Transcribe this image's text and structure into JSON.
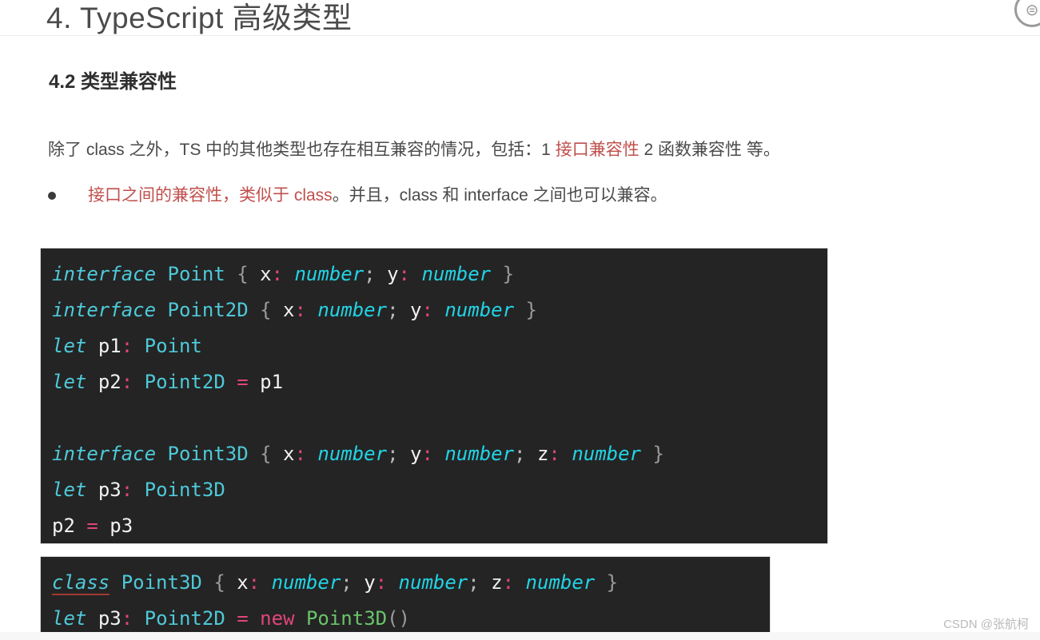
{
  "document": {
    "title": "4. TypeScript 高级类型",
    "section_title": "4.2 类型兼容性"
  },
  "corner_icon": {
    "name": "circular-badge-icon",
    "glyph": "⊜"
  },
  "paragraph": {
    "part1": "除了 class 之外，TS 中的其他类型也存在相互兼容的情况，包括：1 ",
    "highlight": "接口兼容性",
    "part2": " 2 函数兼容性 等。"
  },
  "bullet": {
    "marker": "●",
    "highlight": "接口之间的兼容性，类似于 class",
    "rest": "。并且，class 和 interface 之间也可以兼容。"
  },
  "colors": {
    "highlight_red": "#c0504d",
    "code_background": "#242424",
    "keyword_cyan": "#4ec9d8",
    "type_cyan": "#22d3e5",
    "punct_pink": "#e0457b",
    "ctor_green": "#6ac46a",
    "identifier_white": "#f2f2f2",
    "error_underline": "#a33a33"
  },
  "code_block_1": {
    "language": "typescript",
    "lines": [
      {
        "id": "line-interface-point",
        "tokens": [
          {
            "t": "interface",
            "c": "t-kw"
          },
          {
            "t": " ",
            "c": "t-plain"
          },
          {
            "t": "Point",
            "c": "t-type"
          },
          {
            "t": " ",
            "c": "t-plain"
          },
          {
            "t": "{",
            "c": "t-brace"
          },
          {
            "t": " ",
            "c": "t-plain"
          },
          {
            "t": "x",
            "c": "t-ident"
          },
          {
            "t": ":",
            "c": "t-punct"
          },
          {
            "t": " ",
            "c": "t-plain"
          },
          {
            "t": "number",
            "c": "t-type-it"
          },
          {
            "t": ";",
            "c": "t-semi"
          },
          {
            "t": " ",
            "c": "t-plain"
          },
          {
            "t": "y",
            "c": "t-ident"
          },
          {
            "t": ":",
            "c": "t-punct"
          },
          {
            "t": " ",
            "c": "t-plain"
          },
          {
            "t": "number",
            "c": "t-type-it"
          },
          {
            "t": " ",
            "c": "t-plain"
          },
          {
            "t": "}",
            "c": "t-brace"
          }
        ]
      },
      {
        "id": "line-interface-point2d",
        "tokens": [
          {
            "t": "interface",
            "c": "t-kw"
          },
          {
            "t": " ",
            "c": "t-plain"
          },
          {
            "t": "Point2D",
            "c": "t-type"
          },
          {
            "t": " ",
            "c": "t-plain"
          },
          {
            "t": "{",
            "c": "t-brace"
          },
          {
            "t": " ",
            "c": "t-plain"
          },
          {
            "t": "x",
            "c": "t-ident"
          },
          {
            "t": ":",
            "c": "t-punct"
          },
          {
            "t": " ",
            "c": "t-plain"
          },
          {
            "t": "number",
            "c": "t-type-it"
          },
          {
            "t": ";",
            "c": "t-semi"
          },
          {
            "t": " ",
            "c": "t-plain"
          },
          {
            "t": "y",
            "c": "t-ident"
          },
          {
            "t": ":",
            "c": "t-punct"
          },
          {
            "t": " ",
            "c": "t-plain"
          },
          {
            "t": "number",
            "c": "t-type-it"
          },
          {
            "t": " ",
            "c": "t-plain"
          },
          {
            "t": "}",
            "c": "t-brace"
          }
        ]
      },
      {
        "id": "line-let-p1",
        "tokens": [
          {
            "t": "let",
            "c": "t-kw"
          },
          {
            "t": " ",
            "c": "t-plain"
          },
          {
            "t": "p1",
            "c": "t-ident"
          },
          {
            "t": ":",
            "c": "t-punct"
          },
          {
            "t": " ",
            "c": "t-plain"
          },
          {
            "t": "Point",
            "c": "t-type"
          }
        ]
      },
      {
        "id": "line-let-p2",
        "tokens": [
          {
            "t": "let",
            "c": "t-kw"
          },
          {
            "t": " ",
            "c": "t-plain"
          },
          {
            "t": "p2",
            "c": "t-ident"
          },
          {
            "t": ":",
            "c": "t-punct"
          },
          {
            "t": " ",
            "c": "t-plain"
          },
          {
            "t": "Point2D",
            "c": "t-type"
          },
          {
            "t": " ",
            "c": "t-plain"
          },
          {
            "t": "=",
            "c": "t-punct"
          },
          {
            "t": " ",
            "c": "t-plain"
          },
          {
            "t": "p1",
            "c": "t-ident"
          }
        ]
      },
      {
        "id": "line-blank-1",
        "tokens": []
      },
      {
        "id": "line-interface-point3d",
        "tokens": [
          {
            "t": "interface",
            "c": "t-kw"
          },
          {
            "t": " ",
            "c": "t-plain"
          },
          {
            "t": "Point3D",
            "c": "t-type"
          },
          {
            "t": " ",
            "c": "t-plain"
          },
          {
            "t": "{",
            "c": "t-brace"
          },
          {
            "t": " ",
            "c": "t-plain"
          },
          {
            "t": "x",
            "c": "t-ident"
          },
          {
            "t": ":",
            "c": "t-punct"
          },
          {
            "t": " ",
            "c": "t-plain"
          },
          {
            "t": "number",
            "c": "t-type-it"
          },
          {
            "t": ";",
            "c": "t-semi"
          },
          {
            "t": " ",
            "c": "t-plain"
          },
          {
            "t": "y",
            "c": "t-ident"
          },
          {
            "t": ":",
            "c": "t-punct"
          },
          {
            "t": " ",
            "c": "t-plain"
          },
          {
            "t": "number",
            "c": "t-type-it"
          },
          {
            "t": ";",
            "c": "t-semi"
          },
          {
            "t": " ",
            "c": "t-plain"
          },
          {
            "t": "z",
            "c": "t-ident"
          },
          {
            "t": ":",
            "c": "t-punct"
          },
          {
            "t": " ",
            "c": "t-plain"
          },
          {
            "t": "number",
            "c": "t-type-it"
          },
          {
            "t": " ",
            "c": "t-plain"
          },
          {
            "t": "}",
            "c": "t-brace"
          }
        ]
      },
      {
        "id": "line-let-p3",
        "tokens": [
          {
            "t": "let",
            "c": "t-kw"
          },
          {
            "t": " ",
            "c": "t-plain"
          },
          {
            "t": "p3",
            "c": "t-ident"
          },
          {
            "t": ":",
            "c": "t-punct"
          },
          {
            "t": " ",
            "c": "t-plain"
          },
          {
            "t": "Point3D",
            "c": "t-type"
          }
        ]
      },
      {
        "id": "line-p2-assign-p3",
        "tokens": [
          {
            "t": "p2",
            "c": "t-ident"
          },
          {
            "t": " ",
            "c": "t-plain"
          },
          {
            "t": "=",
            "c": "t-punct"
          },
          {
            "t": " ",
            "c": "t-plain"
          },
          {
            "t": "p3",
            "c": "t-ident"
          }
        ]
      }
    ]
  },
  "code_block_2": {
    "language": "typescript",
    "lines": [
      {
        "id": "line-class-point3d",
        "tokens": [
          {
            "t": "class",
            "c": "t-kw-err"
          },
          {
            "t": " ",
            "c": "t-plain"
          },
          {
            "t": "Point3D",
            "c": "t-type"
          },
          {
            "t": " ",
            "c": "t-plain"
          },
          {
            "t": "{",
            "c": "t-brace"
          },
          {
            "t": " ",
            "c": "t-plain"
          },
          {
            "t": "x",
            "c": "t-ident"
          },
          {
            "t": ":",
            "c": "t-punct"
          },
          {
            "t": " ",
            "c": "t-plain"
          },
          {
            "t": "number",
            "c": "t-type-it"
          },
          {
            "t": ";",
            "c": "t-semi"
          },
          {
            "t": " ",
            "c": "t-plain"
          },
          {
            "t": "y",
            "c": "t-ident"
          },
          {
            "t": ":",
            "c": "t-punct"
          },
          {
            "t": " ",
            "c": "t-plain"
          },
          {
            "t": "number",
            "c": "t-type-it"
          },
          {
            "t": ";",
            "c": "t-semi"
          },
          {
            "t": " ",
            "c": "t-plain"
          },
          {
            "t": "z",
            "c": "t-ident"
          },
          {
            "t": ":",
            "c": "t-punct"
          },
          {
            "t": " ",
            "c": "t-plain"
          },
          {
            "t": "number",
            "c": "t-type-it"
          },
          {
            "t": " ",
            "c": "t-plain"
          },
          {
            "t": "}",
            "c": "t-brace"
          }
        ]
      },
      {
        "id": "line-let-p3-new",
        "tokens": [
          {
            "t": "let",
            "c": "t-kw"
          },
          {
            "t": " ",
            "c": "t-plain"
          },
          {
            "t": "p3",
            "c": "t-ident"
          },
          {
            "t": ":",
            "c": "t-punct"
          },
          {
            "t": " ",
            "c": "t-plain"
          },
          {
            "t": "Point2D",
            "c": "t-type"
          },
          {
            "t": " ",
            "c": "t-plain"
          },
          {
            "t": "=",
            "c": "t-punct"
          },
          {
            "t": " ",
            "c": "t-plain"
          },
          {
            "t": "new",
            "c": "t-new"
          },
          {
            "t": " ",
            "c": "t-plain"
          },
          {
            "t": "Point3D",
            "c": "t-ctor"
          },
          {
            "t": "()",
            "c": "t-paren"
          }
        ]
      }
    ]
  },
  "watermark": {
    "text": "CSDN @张航柯"
  }
}
